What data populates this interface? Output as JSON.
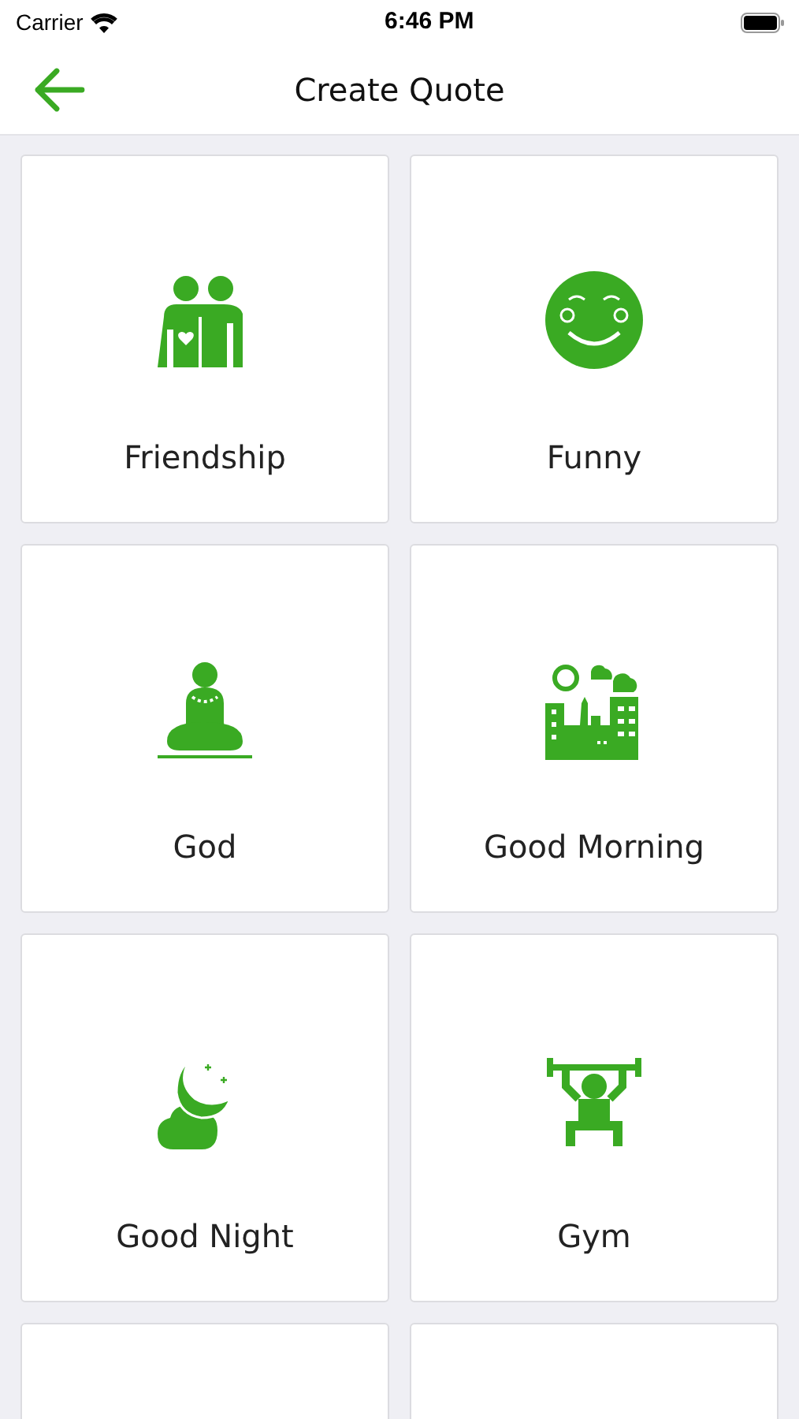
{
  "status_bar": {
    "carrier": "Carrier",
    "time": "6:46 PM"
  },
  "header": {
    "title": "Create Quote"
  },
  "categories": [
    {
      "kind": "friends",
      "label": "Friendship"
    },
    {
      "kind": "smiley",
      "label": "Funny"
    },
    {
      "kind": "meditation",
      "label": "God"
    },
    {
      "kind": "city",
      "label": "Good Morning"
    },
    {
      "kind": "moon",
      "label": "Good Night"
    },
    {
      "kind": "gym",
      "label": "Gym"
    },
    {
      "kind": "cut"
    },
    {
      "kind": "cut"
    }
  ]
}
